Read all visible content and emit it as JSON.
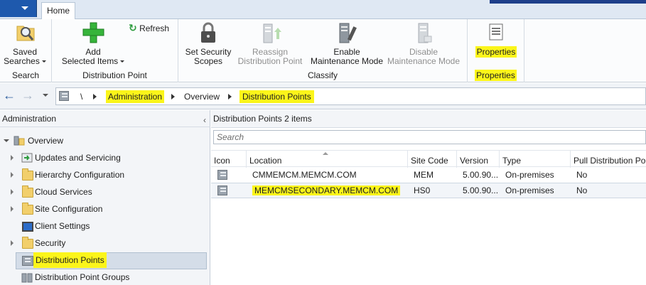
{
  "tabstrip": {
    "home_tab": "Home"
  },
  "ribbon": {
    "groups": {
      "search": {
        "label": "Search",
        "saved_searches": [
          "Saved",
          "Searches"
        ]
      },
      "distribution_point": {
        "label": "Distribution Point",
        "refresh": "Refresh",
        "add_selected_items": [
          "Add",
          "Selected Items"
        ]
      },
      "classify": {
        "label": "Classify",
        "set_security_scopes": [
          "Set Security",
          "Scopes"
        ],
        "reassign": [
          "Reassign",
          "Distribution Point"
        ],
        "enable_maintenance": [
          "Enable",
          "Maintenance Mode"
        ],
        "disable_maintenance": [
          "Disable",
          "Maintenance Mode"
        ]
      },
      "properties": {
        "label": "Properties",
        "properties_button": "Properties"
      }
    }
  },
  "addressbar": {
    "root": "\\",
    "crumbs": [
      "Administration",
      "Overview",
      "Distribution Points"
    ]
  },
  "leftnav": {
    "title": "Administration",
    "items": [
      {
        "label": "Overview"
      },
      {
        "label": "Updates and Servicing"
      },
      {
        "label": "Hierarchy Configuration"
      },
      {
        "label": "Cloud Services"
      },
      {
        "label": "Site Configuration"
      },
      {
        "label": "Client Settings"
      },
      {
        "label": "Security"
      },
      {
        "label": "Distribution Points"
      },
      {
        "label": "Distribution Point Groups"
      }
    ]
  },
  "main": {
    "title": "Distribution Points",
    "count": "2 items",
    "search_placeholder": "Search",
    "columns": [
      "Icon",
      "Location",
      "Site Code",
      "Version",
      "Type",
      "Pull Distribution Point"
    ],
    "rows": [
      {
        "location": "CMMEMCM.MEMCM.COM",
        "site_code": "MEM",
        "version": "5.00.90...",
        "type": "On-premises",
        "pull": "No"
      },
      {
        "location": "MEMCMSECONDARY.MEMCM.COM",
        "site_code": "HS0",
        "version": "5.00.90...",
        "type": "On-premises",
        "pull": "No"
      }
    ]
  },
  "colors": {
    "highlight": "#fbf51a",
    "app_menu": "#1e59ad",
    "selection": "#d4dde8"
  }
}
